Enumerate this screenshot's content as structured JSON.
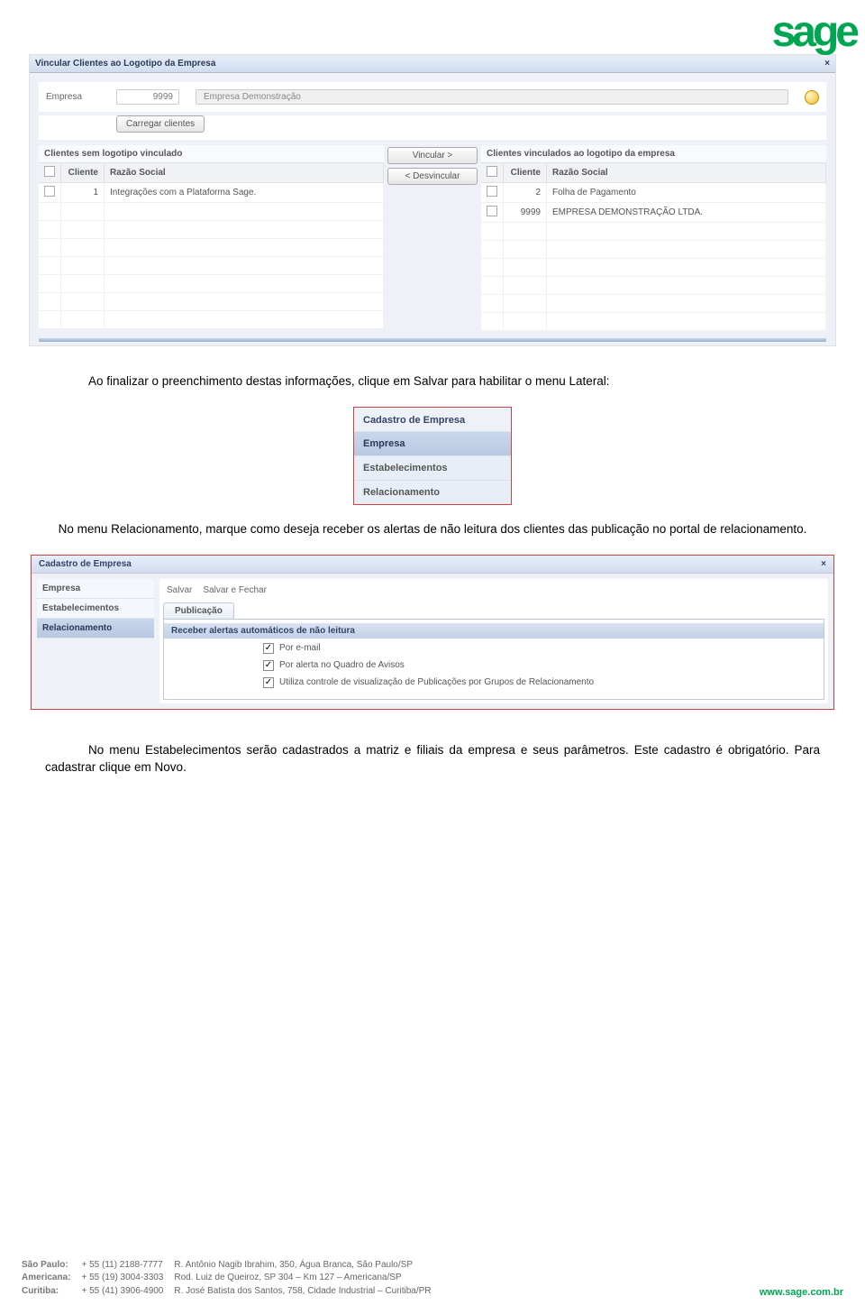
{
  "logo": "sage",
  "dialog1": {
    "title": "Vincular Clientes ao Logotipo da Empresa",
    "close": "×",
    "empresa_label": "Empresa",
    "empresa_code": "9999",
    "empresa_name": "Empresa Demonstração",
    "load_button": "Carregar clientes",
    "left_panel_title": "Clientes sem logotipo vinculado",
    "right_panel_title": "Clientes vinculados ao logotipo da empresa",
    "th_cliente": "Cliente",
    "th_razao": "Razão Social",
    "btn_link": "Vincular >",
    "btn_unlink": "< Desvincular",
    "left_rows": {
      "r1_cliente": "1",
      "r1_razao": "Integrações com a Plataforma Sage."
    },
    "right_rows": {
      "r1_cliente": "2",
      "r1_razao": "Folha de Pagamento",
      "r2_cliente": "9999",
      "r2_razao": "EMPRESA DEMONSTRAÇÃO LTDA."
    }
  },
  "doc": {
    "p1": "Ao finalizar o preenchimento destas informações, clique em Salvar para habilitar o menu Lateral:",
    "p2": "No menu Relacionamento, marque como deseja receber os alertas de não leitura dos clientes das publicação no portal de relacionamento.",
    "p3": "No menu Estabelecimentos serão cadastrados a matriz e filiais da empresa e seus parâmetros. Este cadastro é obrigatório. Para cadastrar clique em Novo."
  },
  "menu_shot": {
    "title": "Cadastro de Empresa",
    "i1": "Empresa",
    "i2": "Estabelecimentos",
    "i3": "Relacionamento"
  },
  "dialog2": {
    "title": "Cadastro de Empresa",
    "close": "×",
    "side": {
      "s1": "Empresa",
      "s2": "Estabelecimentos",
      "s3": "Relacionamento"
    },
    "toolbar": {
      "t1": "Salvar",
      "t2": "Salvar e Fechar"
    },
    "tab": "Publicação",
    "subheader": "Receber alertas automáticos de não leitura",
    "opts": {
      "o1": "Por e-mail",
      "o2": "Por alerta no Quadro de Avisos",
      "o3": "Utiliza controle de visualização de Publicações por Grupos de Relacionamento"
    }
  },
  "footer": {
    "c1": "São Paulo:",
    "c2": "Americana:",
    "c3": "Curitiba:",
    "p1": "+ 55 (11) 2188-7777",
    "p2": "+ 55 (19) 3004-3303",
    "p3": "+ 55 (41) 3906-4900",
    "a1": "R. Antônio Nagib Ibrahim, 350, Água Branca, São Paulo/SP",
    "a2": "Rod. Luiz de Queiroz, SP 304 – Km 127 – Americana/SP",
    "a3": "R. José Batista dos Santos, 758, Cidade Industrial – Curitiba/PR",
    "link": "www.sage.com.br"
  }
}
